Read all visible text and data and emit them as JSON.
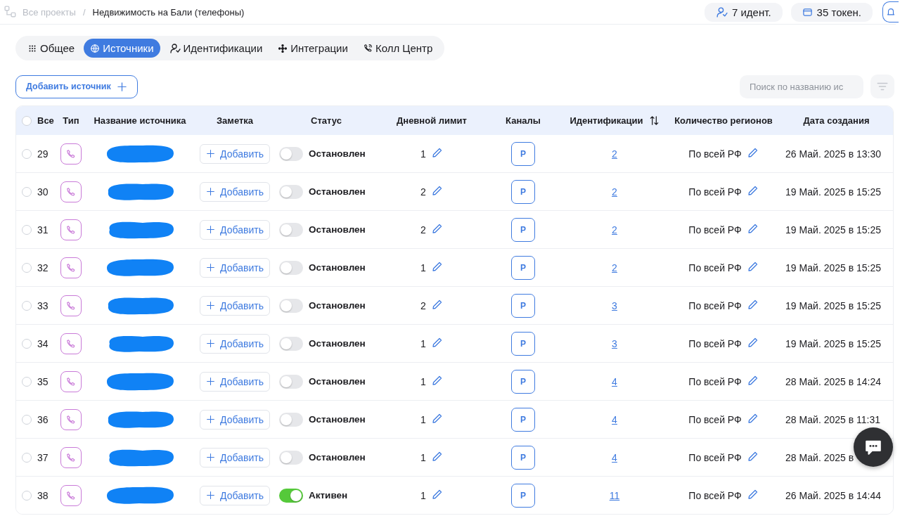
{
  "breadcrumbs": [
    {
      "label": "Все проекты",
      "current": false
    },
    {
      "separator": "/",
      "label": "Недвижимость на Бали (телефоны)",
      "current": true
    }
  ],
  "select_all": {
    "checked": false
  },
  "counters": [
    {
      "kind": "ident",
      "label": "7 идент."
    },
    {
      "kind": "token",
      "label": "35 токен."
    }
  ],
  "tabs": [
    {
      "kind": "grid",
      "label": "Общее",
      "selected": false
    },
    {
      "kind": "globe",
      "label": "Источники",
      "selected": true
    },
    {
      "kind": "person",
      "label": "Идентификации",
      "selected": false
    },
    {
      "kind": "integrations",
      "label": "Интеграции",
      "selected": false
    },
    {
      "kind": "phone",
      "label": "Колл Центр",
      "selected": false
    }
  ],
  "add_button": "Добавить источник",
  "search": {
    "placeholder": "Поиск по названию ис"
  },
  "table": {
    "columns": [
      "Все",
      "Тип",
      "Название источника",
      "Заметка",
      "Статус",
      "Дневной лимит",
      "Каналы",
      "Идентификации",
      "Количество регионов",
      "Дата создания"
    ],
    "rows": [
      {
        "selected": false,
        "number": "29",
        "note": "Добавить",
        "active": false,
        "status": "Остановлен",
        "limit": "1",
        "channel": "P",
        "identifications": "2",
        "regions": "По всей РФ",
        "created": "26 Май. 2025 в 13:30"
      },
      {
        "selected": false,
        "number": "30",
        "note": "Добавить",
        "active": false,
        "status": "Остановлен",
        "limit": "2",
        "channel": "P",
        "identifications": "2",
        "regions": "По всей РФ",
        "created": "19 Май. 2025 в 15:25"
      },
      {
        "selected": false,
        "number": "31",
        "note": "Добавить",
        "active": false,
        "status": "Остановлен",
        "limit": "2",
        "channel": "P",
        "identifications": "2",
        "regions": "По всей РФ",
        "created": "19 Май. 2025 в 15:25"
      },
      {
        "selected": false,
        "number": "32",
        "note": "Добавить",
        "active": false,
        "status": "Остановлен",
        "limit": "1",
        "channel": "P",
        "identifications": "2",
        "regions": "По всей РФ",
        "created": "19 Май. 2025 в 15:25"
      },
      {
        "selected": false,
        "number": "33",
        "note": "Добавить",
        "active": false,
        "status": "Остановлен",
        "limit": "2",
        "channel": "P",
        "identifications": "3",
        "regions": "По всей РФ",
        "created": "19 Май. 2025 в 15:25"
      },
      {
        "selected": false,
        "number": "34",
        "note": "Добавить",
        "active": false,
        "status": "Остановлен",
        "limit": "1",
        "channel": "P",
        "identifications": "3",
        "regions": "По всей РФ",
        "created": "19 Май. 2025 в 15:25"
      },
      {
        "selected": false,
        "number": "35",
        "note": "Добавить",
        "active": false,
        "status": "Остановлен",
        "limit": "1",
        "channel": "P",
        "identifications": "4",
        "regions": "По всей РФ",
        "created": "28 Май. 2025 в 14:24"
      },
      {
        "selected": false,
        "number": "36",
        "note": "Добавить",
        "active": false,
        "status": "Остановлен",
        "limit": "1",
        "channel": "P",
        "identifications": "4",
        "regions": "По всей РФ",
        "created": "28 Май. 2025 в 11:31"
      },
      {
        "selected": false,
        "number": "37",
        "note": "Добавить",
        "active": false,
        "status": "Остановлен",
        "limit": "1",
        "channel": "P",
        "identifications": "4",
        "regions": "По всей РФ",
        "created": "28 Май. 2025 в"
      },
      {
        "selected": false,
        "number": "38",
        "note": "Добавить",
        "active": true,
        "status": "Активен",
        "limit": "1",
        "channel": "P",
        "identifications": "11",
        "regions": "По всей РФ",
        "created": "26 Май. 2025 в 14:44"
      }
    ]
  }
}
